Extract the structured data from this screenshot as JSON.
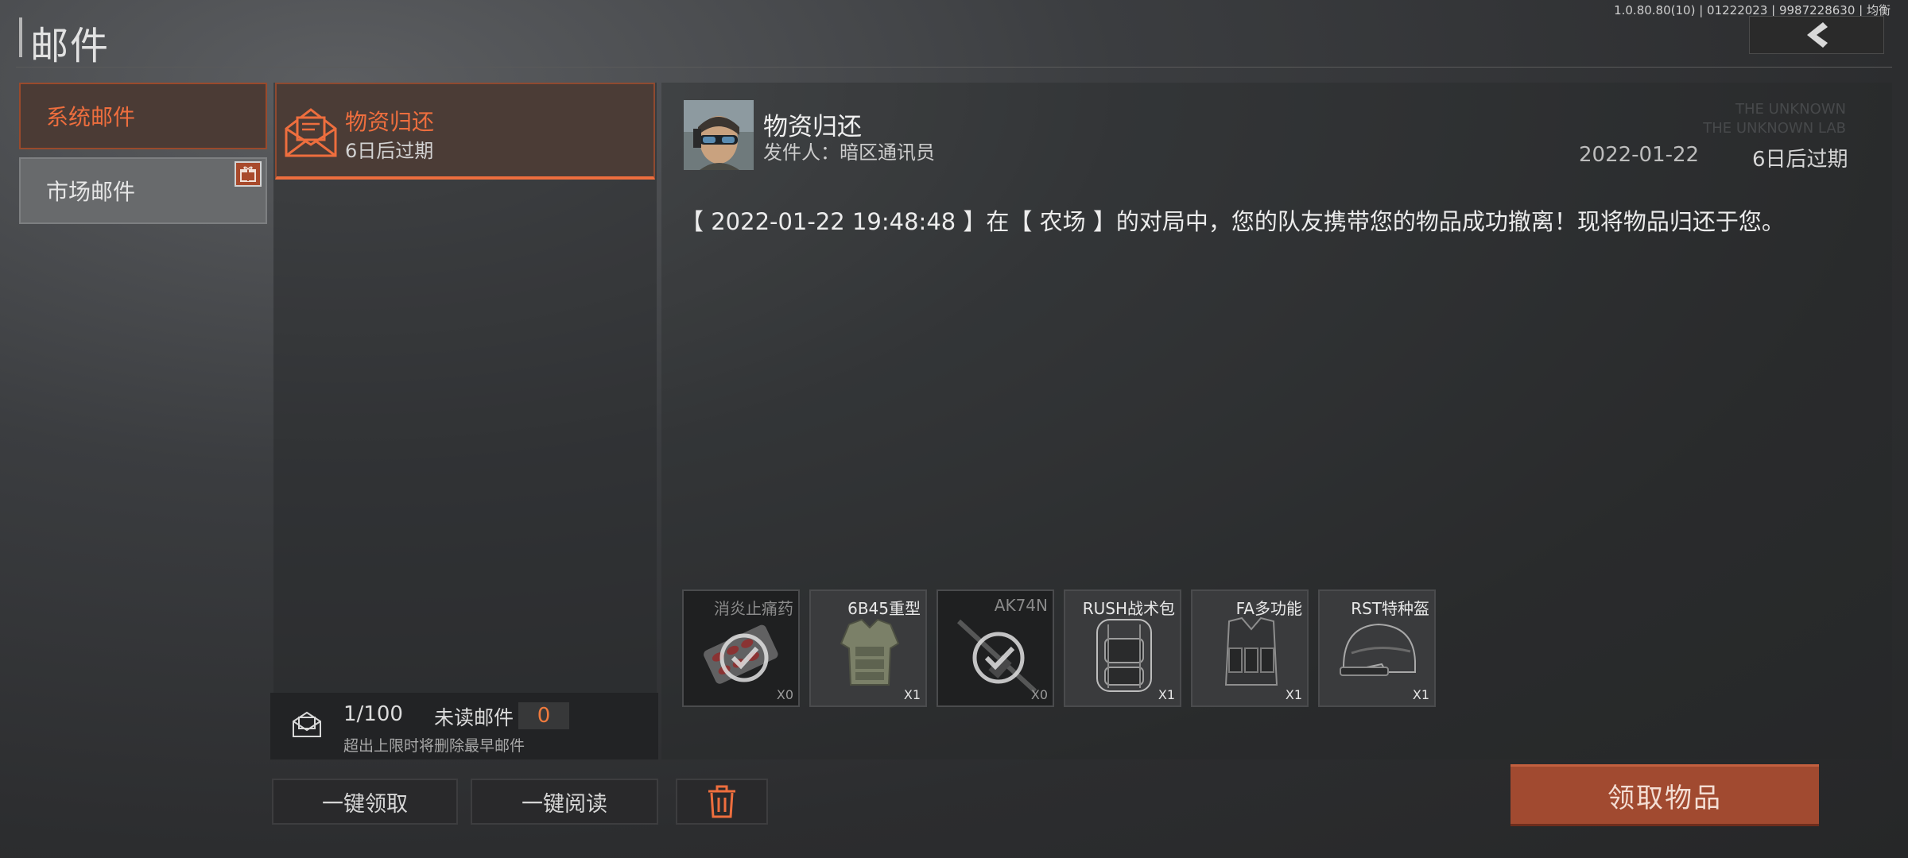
{
  "header": {
    "title": "邮件",
    "version_info": "1.0.80.80(10) | 01222023 | 9987228630 | 均衡",
    "back_icon": "chevron-left-icon"
  },
  "categories": [
    {
      "label": "系统邮件",
      "selected": true
    },
    {
      "label": "市场邮件",
      "selected": false,
      "badge_icon": "gift-icon"
    }
  ],
  "mail_list": [
    {
      "subject": "物资归还",
      "expiry": "6日后过期",
      "icon": "open-envelope-icon",
      "selected": true
    }
  ],
  "mailbox": {
    "count": "1/100",
    "unread_label": "未读邮件",
    "unread_count": "0",
    "note": "超出上限时将删除最早邮件"
  },
  "actions": {
    "collect_all": "一键领取",
    "read_all": "一键阅读",
    "delete_icon": "trash-icon",
    "claim": "领取物品"
  },
  "detail": {
    "subject": "物资归还",
    "sender": "发件人：暗区通讯员",
    "date": "2022-01-22",
    "expiry": "6日后过期",
    "body": "【 2022-01-22 19:48:48 】在【 农场 】的对局中，您的队友携带您的物品成功撤离！现将物品归还于您。",
    "attachments": [
      {
        "name": "消炎止痛药",
        "qty": "X0",
        "icon": "pills-icon"
      },
      {
        "name": "6B45重型",
        "qty": "X1",
        "icon": "body-armor-icon"
      },
      {
        "name": "AK74N",
        "qty": "X0",
        "icon": "rifle-icon"
      },
      {
        "name": "RUSH战术包",
        "qty": "X1",
        "icon": "backpack-icon"
      },
      {
        "name": "FA多功能",
        "qty": "X1",
        "icon": "tactical-vest-icon"
      },
      {
        "name": "RST特种盔",
        "qty": "X1",
        "icon": "helmet-icon"
      }
    ]
  },
  "colors": {
    "accent": "#ee6e3e",
    "claim_button": "#a14a30"
  }
}
